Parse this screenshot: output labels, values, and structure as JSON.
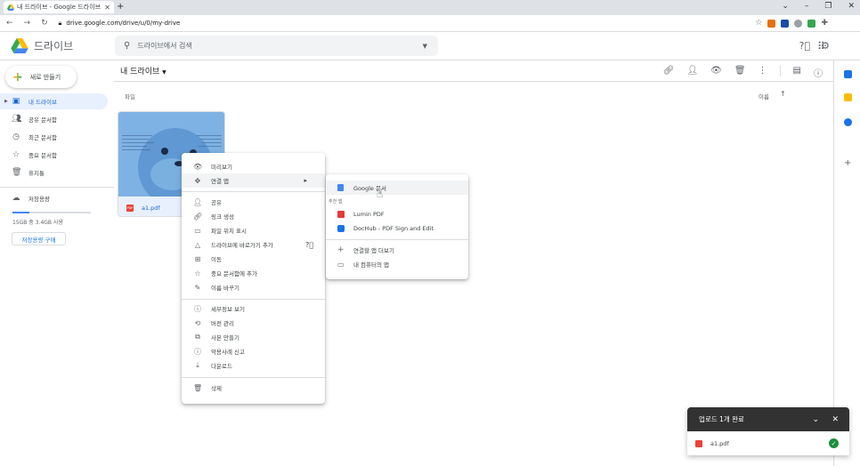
{
  "browser": {
    "tab_title": "내 드라이브 - Google 드라이브",
    "url": "drive.google.com/drive/u/0/my-drive"
  },
  "app": {
    "product_name": "드라이브",
    "search_placeholder": "드라이브에서 검색"
  },
  "sidebar": {
    "new_button": "새로 만들기",
    "items": [
      {
        "label": "내 드라이브",
        "icon": "my-drive-icon",
        "active": true
      },
      {
        "label": "공유 문서함",
        "icon": "shared-icon"
      },
      {
        "label": "최근 문서함",
        "icon": "clock-icon"
      },
      {
        "label": "중요 문서함",
        "icon": "star-icon"
      },
      {
        "label": "휴지통",
        "icon": "trash-icon"
      }
    ],
    "storage_label": "저장용량",
    "storage_usage_text": "15GB 중 3.4GB 사용",
    "storage_fraction": 0.22,
    "buy_storage_button": "저장용량 구매"
  },
  "main": {
    "title": "내 드라이브",
    "section_label": "파일",
    "sort_label": "이름",
    "file": {
      "name": "a1.pdf",
      "type_badge": "PDF"
    }
  },
  "context_menu": {
    "items": [
      {
        "label": "미리보기",
        "icon": "eye-icon"
      },
      {
        "label": "연결 앱",
        "icon": "move-icon",
        "submenu": true
      },
      {
        "label": "공유",
        "icon": "person-add-icon"
      },
      {
        "label": "링크 생성",
        "icon": "link-icon"
      },
      {
        "label": "파일 위치 표시",
        "icon": "folder-icon"
      },
      {
        "label": "드라이브에 바로가기 추가",
        "icon": "drive-shortcut-icon",
        "help": true
      },
      {
        "label": "이동",
        "icon": "move-to-folder-icon"
      },
      {
        "label": "중요 문서함에 추가",
        "icon": "star-icon"
      },
      {
        "label": "이름 바꾸기",
        "icon": "pencil-icon"
      },
      {
        "label": "세부정보 보기",
        "icon": "info-icon"
      },
      {
        "label": "버전 관리",
        "icon": "history-icon"
      },
      {
        "label": "사본 만들기",
        "icon": "copy-icon"
      },
      {
        "label": "악용사례 신고",
        "icon": "report-icon"
      },
      {
        "label": "다운로드",
        "icon": "download-icon"
      },
      {
        "label": "삭제",
        "icon": "trash-icon"
      }
    ]
  },
  "open_with_menu": {
    "google_docs": "Google 문서",
    "suggested_label": "추천 앱",
    "apps": [
      {
        "label": "Lumin PDF",
        "color": "#e53935"
      },
      {
        "label": "DocHub - PDF Sign and Edit",
        "color": "#1a73e8"
      }
    ],
    "more_apps": "연결할 앱 더보기",
    "computer_apps": "내 컴퓨터의 앱"
  },
  "upload_panel": {
    "title": "업로드 1개 완료",
    "file_name": "a1.pdf"
  },
  "colors": {
    "accent": "#1a73e8",
    "active_bg": "#e8f0fe",
    "success": "#1e8e3e"
  }
}
